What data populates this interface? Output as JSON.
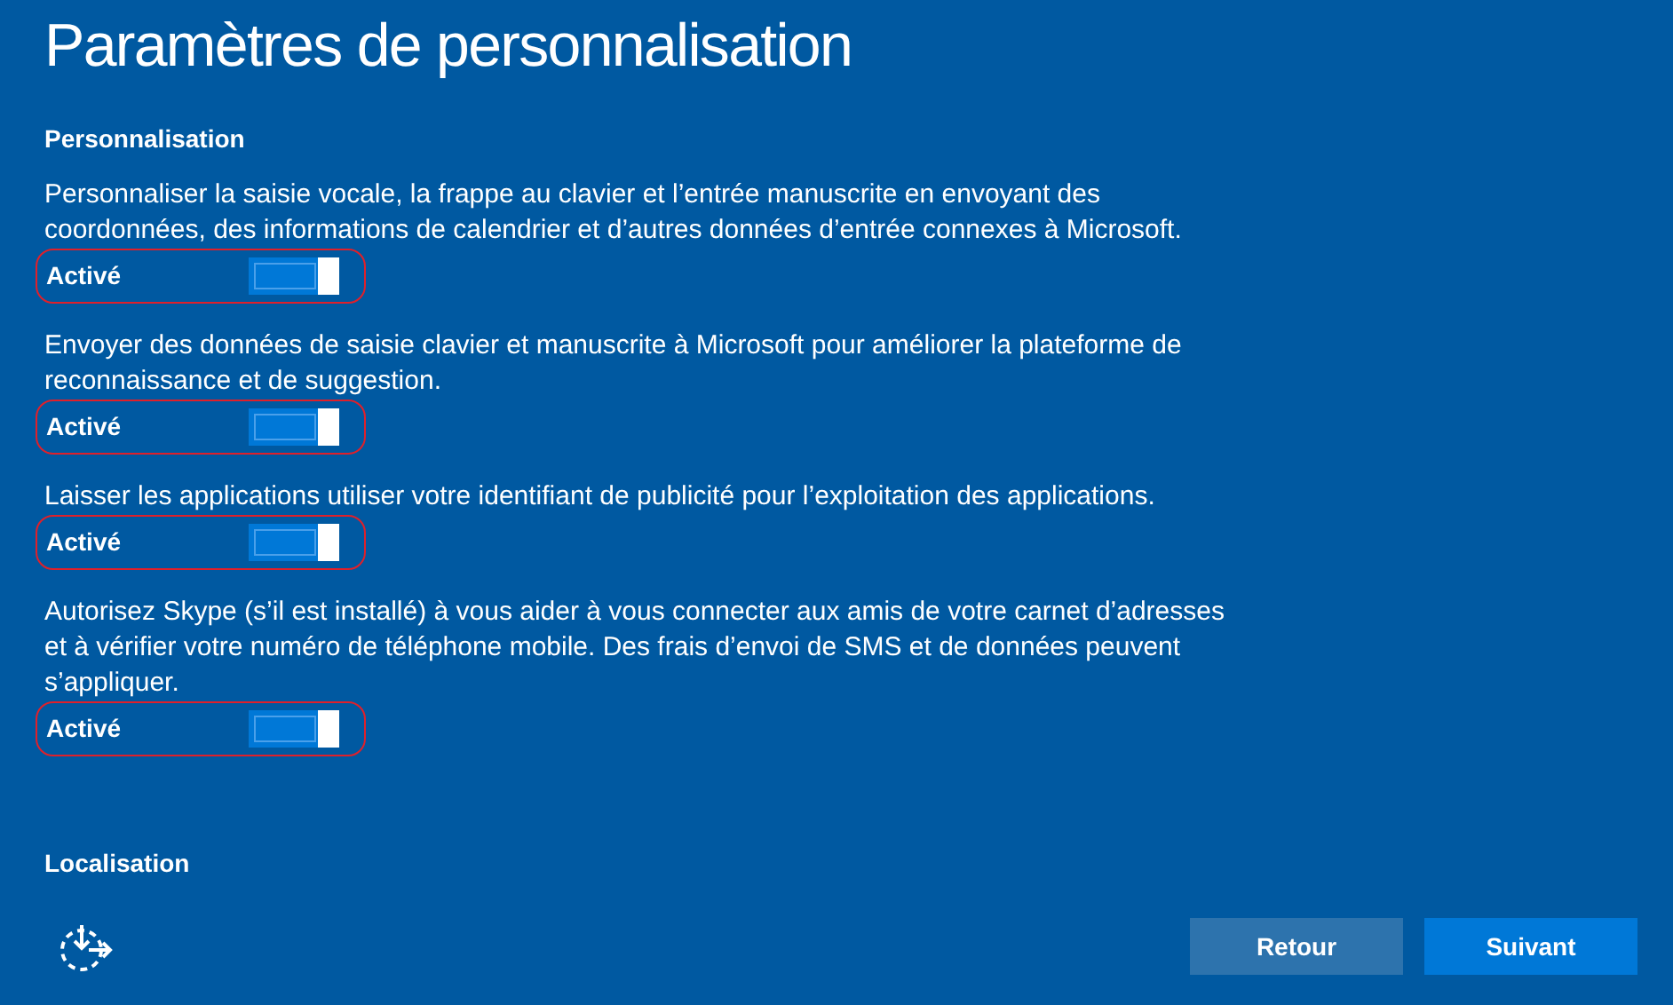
{
  "title": "Paramètres de personnalisation",
  "sections": [
    {
      "heading": "Personnalisation",
      "settings": [
        {
          "description": "Personnaliser la saisie vocale, la frappe au clavier et l’entrée manuscrite en envoyant des coordonnées, des informations de calendrier et d’autres données d’entrée connexes à Microsoft.",
          "state_label": "Activé",
          "on": true,
          "highlighted": true
        },
        {
          "description": "Envoyer des données de saisie clavier et manuscrite à Microsoft pour améliorer la plateforme de reconnaissance et de suggestion.",
          "state_label": "Activé",
          "on": true,
          "highlighted": true
        },
        {
          "description": "Laisser les applications utiliser votre identifiant de publicité pour l’exploitation des applications.",
          "state_label": "Activé",
          "on": true,
          "highlighted": true
        },
        {
          "description": "Autorisez Skype (s’il est installé) à vous aider à vous connecter aux amis de votre carnet d’adresses et à vérifier votre numéro de téléphone mobile. Des frais d’envoi de SMS et de données peuvent s’appliquer.",
          "state_label": "Activé",
          "on": true,
          "highlighted": true
        }
      ]
    },
    {
      "heading": "Localisation"
    }
  ],
  "buttons": [
    {
      "label": "Retour",
      "kind": "secondary"
    },
    {
      "label": "Suivant",
      "kind": "primary"
    }
  ]
}
